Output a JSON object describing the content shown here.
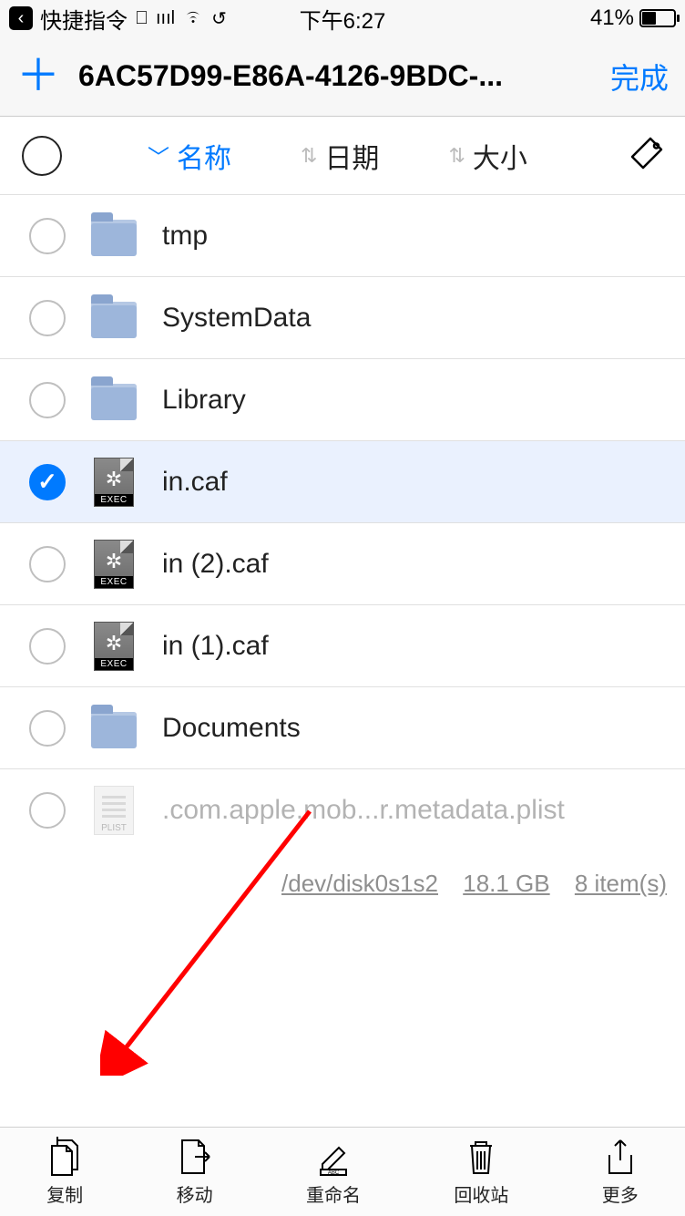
{
  "status": {
    "app": "快捷指令",
    "time": "下午6:27",
    "battery": "41%"
  },
  "header": {
    "title": "6AC57D99-E86A-4126-9BDC-...",
    "done": "完成"
  },
  "sort": {
    "name": "名称",
    "date": "日期",
    "size": "大小"
  },
  "files": [
    {
      "name": "tmp",
      "type": "folder",
      "selected": false
    },
    {
      "name": "SystemData",
      "type": "folder",
      "selected": false
    },
    {
      "name": "Library",
      "type": "folder",
      "selected": false
    },
    {
      "name": "in.caf",
      "type": "exec",
      "selected": true
    },
    {
      "name": "in (2).caf",
      "type": "exec",
      "selected": false
    },
    {
      "name": "in (1).caf",
      "type": "exec",
      "selected": false
    },
    {
      "name": "Documents",
      "type": "folder",
      "selected": false
    },
    {
      "name": ".com.apple.mob...r.metadata.plist",
      "type": "plist",
      "selected": false,
      "dim": true
    }
  ],
  "footer": {
    "path": "/dev/disk0s1s2",
    "size": "18.1 GB",
    "count": "8 item(s)"
  },
  "toolbar": {
    "copy": "复制",
    "move": "移动",
    "rename": "重命名",
    "trash": "回收站",
    "more": "更多"
  },
  "iconLabels": {
    "exec": "EXEC",
    "plist": "PLIST"
  }
}
